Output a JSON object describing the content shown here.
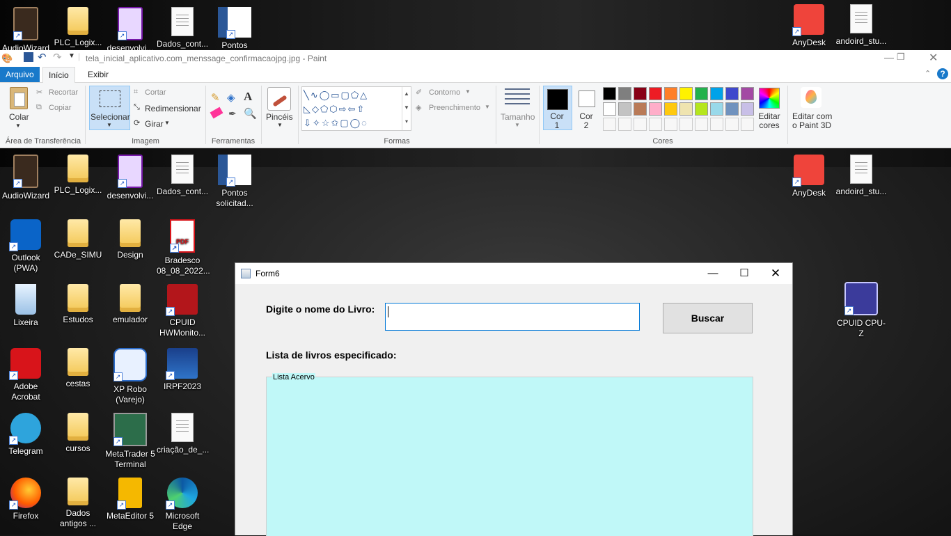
{
  "desktop_top": [
    {
      "label": "AudioWizard",
      "icon": "speaker-icon"
    },
    {
      "label": "PLC_Logix...",
      "icon": "folder-icon"
    },
    {
      "label": "desenvolvi...",
      "icon": "onenote-icon"
    },
    {
      "label": "Dados_cont...",
      "icon": "document-icon"
    },
    {
      "label": "Pontos",
      "icon": "word-icon"
    },
    {
      "label": "AnyDesk",
      "icon": "anydesk-icon"
    },
    {
      "label": "andoird_stu...",
      "icon": "document-icon"
    }
  ],
  "desktop": [
    {
      "label": "AudioWizard",
      "icon": "speaker-icon"
    },
    {
      "label": "PLC_Logix...",
      "icon": "folder-icon"
    },
    {
      "label": "desenvolvi...",
      "icon": "onenote-icon"
    },
    {
      "label": "Dados_cont...",
      "icon": "document-icon"
    },
    {
      "label": "Pontos solicitad...",
      "icon": "word-icon"
    },
    {
      "label": "AnyDesk",
      "icon": "anydesk-icon"
    },
    {
      "label": "andoird_stu...",
      "icon": "document-icon"
    },
    {
      "label": "Outlook (PWA)",
      "icon": "outlook-icon"
    },
    {
      "label": "CADe_SIMU",
      "icon": "folder-icon"
    },
    {
      "label": "Design",
      "icon": "folder-icon"
    },
    {
      "label": "Bradesco 08_08_2022...",
      "icon": "pdf-icon"
    },
    {
      "label": "Lixeira",
      "icon": "recycle-bin-icon"
    },
    {
      "label": "Estudos",
      "icon": "folder-icon"
    },
    {
      "label": "emulador",
      "icon": "folder-icon"
    },
    {
      "label": "CPUID HWMonito...",
      "icon": "hwmonitor-icon"
    },
    {
      "label": "CPUID CPU-Z",
      "icon": "cpuz-icon"
    },
    {
      "label": "Adobe Acrobat",
      "icon": "acrobat-icon"
    },
    {
      "label": "cestas",
      "icon": "folder-icon"
    },
    {
      "label": "XP Robo (Varejo)",
      "icon": "robot-icon"
    },
    {
      "label": "IRPF2023",
      "icon": "irpf-icon"
    },
    {
      "label": "Telegram",
      "icon": "telegram-icon"
    },
    {
      "label": "cursos",
      "icon": "folder-icon"
    },
    {
      "label": "MetaTrader 5 Terminal",
      "icon": "metatrader-icon"
    },
    {
      "label": "criação_de_...",
      "icon": "document-icon"
    },
    {
      "label": "Firefox",
      "icon": "firefox-icon"
    },
    {
      "label": "Dados antigos ...",
      "icon": "folder-icon"
    },
    {
      "label": "MetaEditor 5",
      "icon": "metaeditor-icon"
    },
    {
      "label": "Microsoft Edge",
      "icon": "edge-icon"
    }
  ],
  "paint": {
    "title": "tela_inicial_aplicativo.com_menssage_confirmacaojpg.jpg - Paint",
    "tabs": [
      "Arquivo",
      "Início",
      "Exibir"
    ],
    "clipboard": {
      "paste": "Colar",
      "cut": "Recortar",
      "copy": "Copiar",
      "group": "Área de Transferência"
    },
    "image": {
      "select": "Selecionar",
      "crop": "Cortar",
      "resize": "Redimensionar",
      "rotate": "Girar",
      "group": "Imagem"
    },
    "tools": {
      "group": "Ferramentas"
    },
    "brushes": "Pincéis",
    "shapes": {
      "outline": "Contorno",
      "fill": "Preenchimento",
      "group": "Formas"
    },
    "size": "Tamanho",
    "color1": "Cor 1",
    "color2": "Cor 2",
    "edit_colors": "Editar cores",
    "paint3d": "Editar com o Paint 3D",
    "colors_group": "Cores",
    "palette": [
      "#000000",
      "#7f7f7f",
      "#880015",
      "#ed1c24",
      "#ff7f27",
      "#fff200",
      "#22b14c",
      "#00a2e8",
      "#3f48cc",
      "#a349a4",
      "#ffffff",
      "#c3c3c3",
      "#b97a57",
      "#ffaec9",
      "#ffc90e",
      "#efe4b0",
      "#b5e61d",
      "#99d9ea",
      "#7092be",
      "#c8bfe7"
    ]
  },
  "form": {
    "title": "Form6",
    "prompt": "Digite o nome do Livro:",
    "input_value": "",
    "search_button": "Buscar",
    "list_label": "Lista de livros especificado:",
    "group_label": "Lista Acervo",
    "list_bg": "#c0f8f8"
  }
}
